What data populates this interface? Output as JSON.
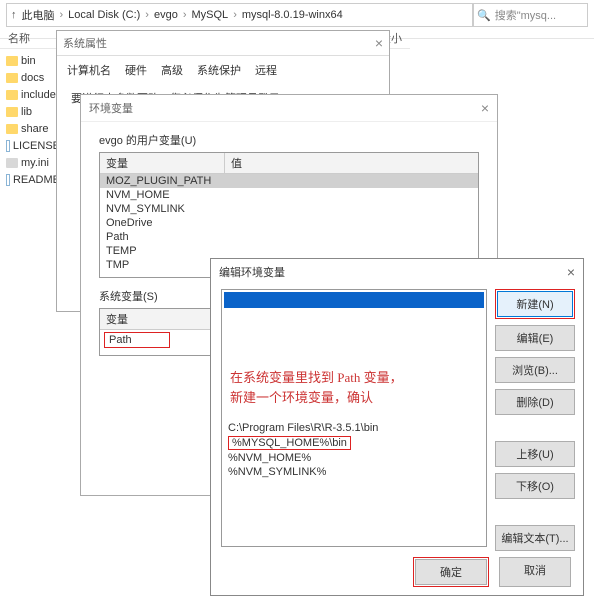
{
  "explorer": {
    "breadcrumb": [
      "此电脑",
      "Local Disk (C:)",
      "evgo",
      "MySQL",
      "mysql-8.0.19-winx64"
    ],
    "search_placeholder": "搜索\"mysq...",
    "name_col": "名称",
    "size_col": "大小",
    "files": [
      "bin",
      "docs",
      "include",
      "lib",
      "share",
      "LICENSE",
      "my.ini",
      "README"
    ]
  },
  "sysprops": {
    "title": "系统属性",
    "tabs": [
      "计算机名",
      "硬件",
      "高级",
      "系统保护",
      "远程"
    ],
    "message": "要进行大多数更改，您必须作为管理员登录。"
  },
  "envvars": {
    "title": "环境变量",
    "user_section": "evgo 的用户变量(U)",
    "col_var": "变量",
    "col_val": "值",
    "user_vars": [
      "MOZ_PLUGIN_PATH",
      "NVM_HOME",
      "NVM_SYMLINK",
      "OneDrive",
      "Path",
      "TEMP",
      "TMP"
    ],
    "sys_section": "系统变量(S)",
    "sys_path": "Path"
  },
  "editdlg": {
    "title": "编辑环境变量",
    "annotation_l1": "在系统变量里找到 Path 变量，",
    "annotation_l2": "新建一个环境变量，确认",
    "paths": [
      "C:\\Program Files\\R\\R-3.5.1\\bin",
      "%MYSQL_HOME%\\bin",
      "%NVM_HOME%",
      "%NVM_SYMLINK%"
    ],
    "buttons": {
      "new": "新建(N)",
      "edit": "编辑(E)",
      "browse": "浏览(B)...",
      "delete": "删除(D)",
      "up": "上移(U)",
      "down": "下移(O)",
      "edit_text": "编辑文本(T)...",
      "ok": "确定",
      "cancel": "取消"
    }
  }
}
